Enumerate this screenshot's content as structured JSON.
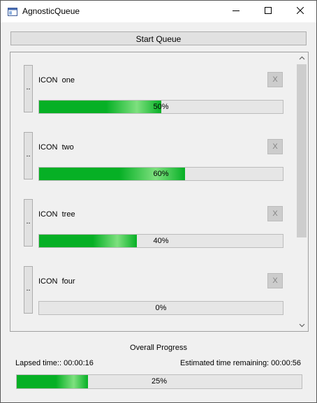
{
  "window": {
    "title": "AgnosticQueue"
  },
  "toolbar": {
    "start_label": "Start Queue"
  },
  "queue": {
    "items": [
      {
        "handle": "..",
        "label": "ICON  one",
        "close": "X",
        "progress": 50,
        "progress_text": "50%"
      },
      {
        "handle": "..",
        "label": "ICON  two",
        "close": "X",
        "progress": 60,
        "progress_text": "60%"
      },
      {
        "handle": "..",
        "label": "ICON  tree",
        "close": "X",
        "progress": 40,
        "progress_text": "40%"
      },
      {
        "handle": "..",
        "label": "ICON  four",
        "close": "X",
        "progress": 0,
        "progress_text": "0%"
      }
    ]
  },
  "overall": {
    "title": "Overall Progress",
    "lapsed": "Lapsed time:: 00:00:16",
    "remaining": "Estimated time remaining: 00:00:56",
    "progress": 25,
    "progress_text": "25%"
  },
  "colors": {
    "progress_fill": "#06b025",
    "progress_track": "#e6e6e6"
  },
  "icons": {
    "app": "app-window-icon",
    "minimize": "minimize-icon",
    "maximize": "maximize-icon",
    "close": "close-icon"
  }
}
